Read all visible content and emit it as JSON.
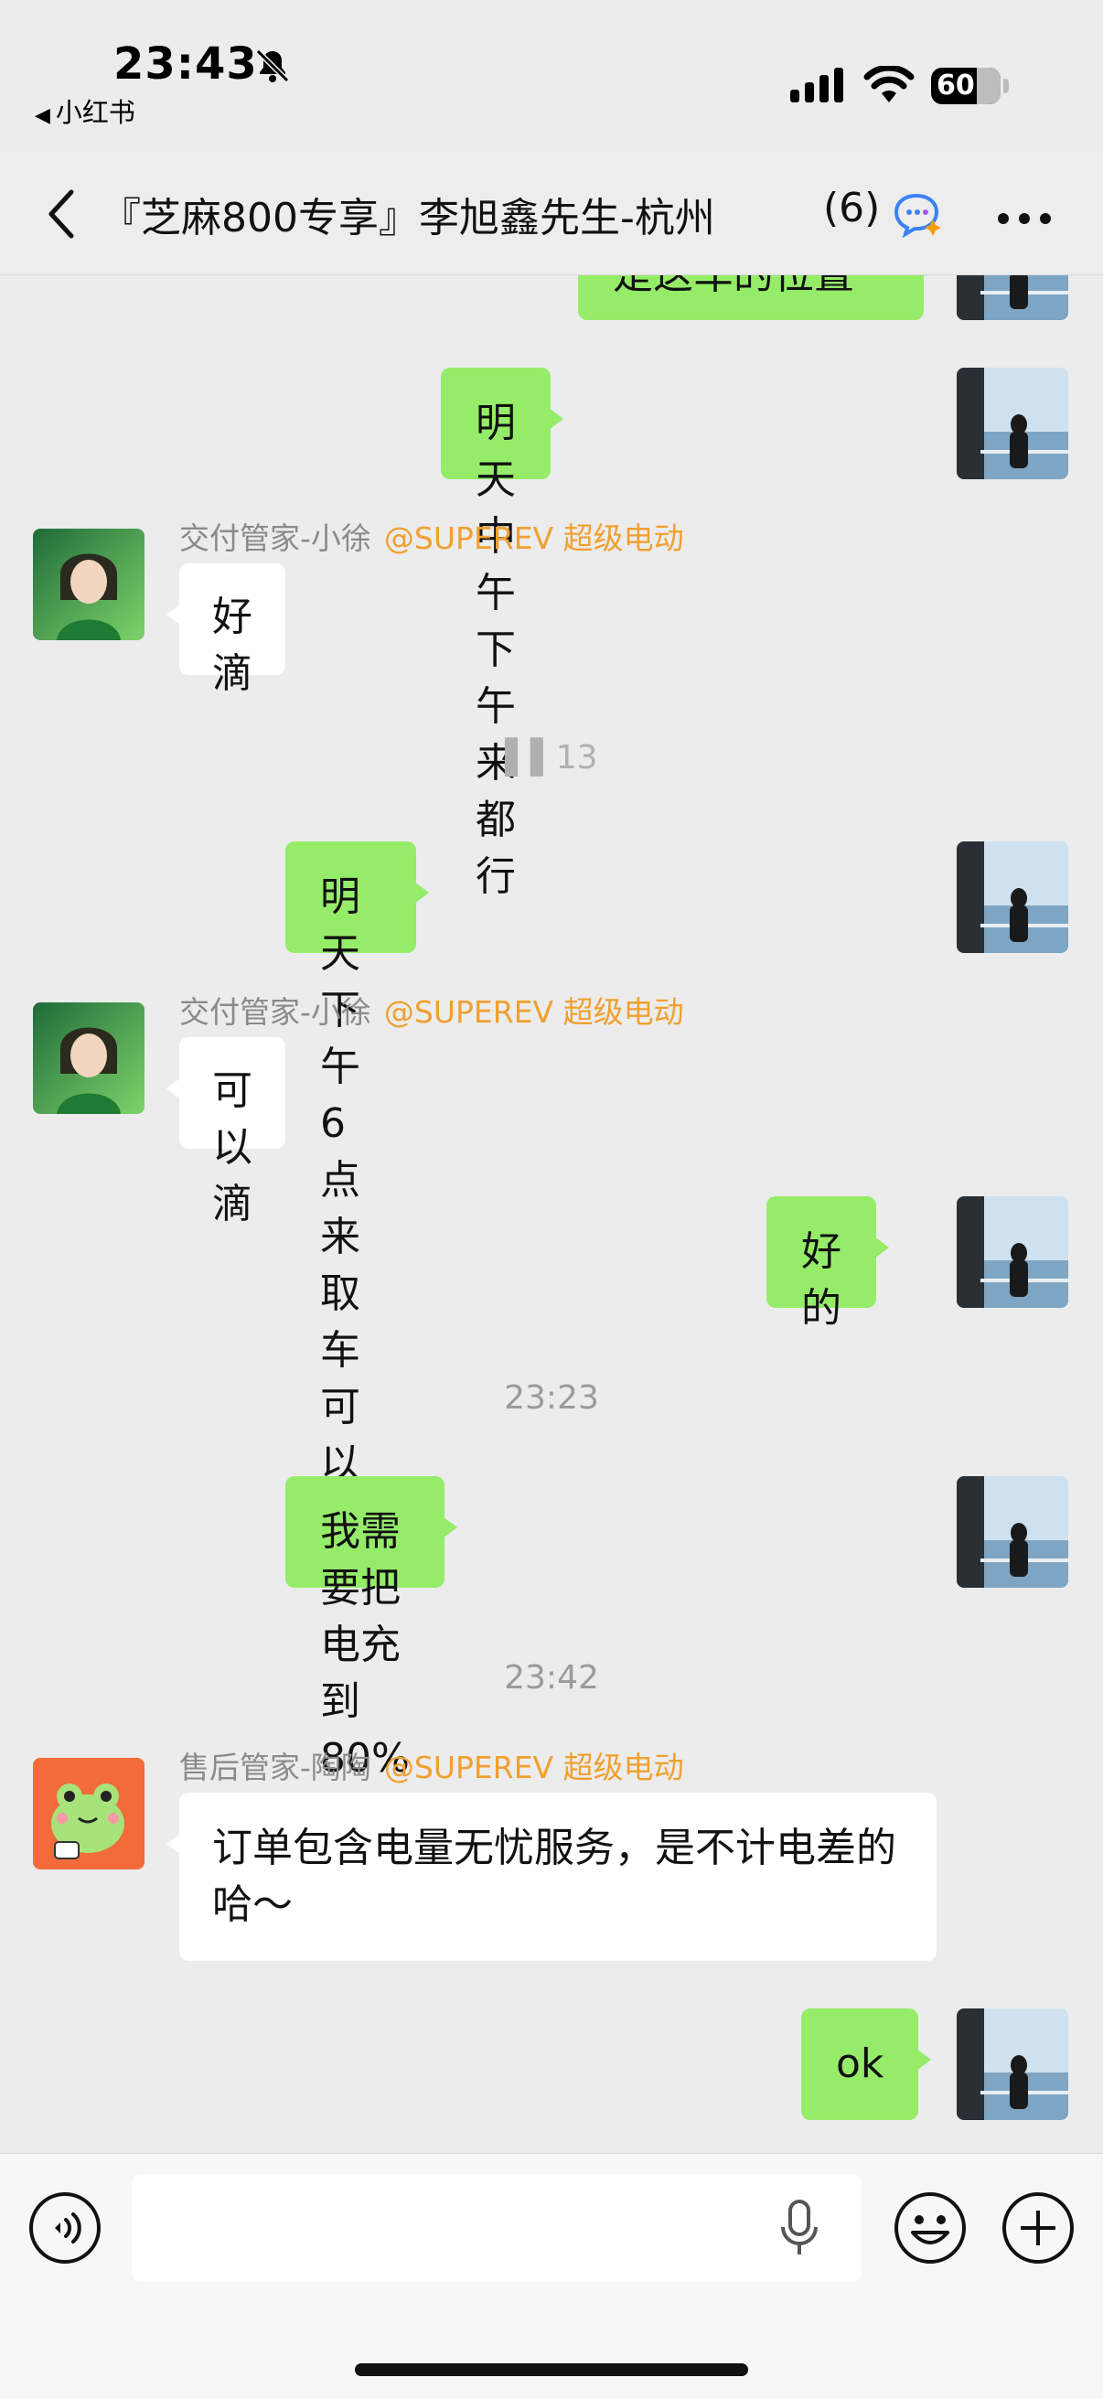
{
  "status": {
    "time": "23:43",
    "back_app": "小红书",
    "battery": "60"
  },
  "header": {
    "title": "『芝麻800专享』李旭鑫先生-杭州",
    "count": "(6)"
  },
  "messages": {
    "m0": {
      "text": "是这车的位置"
    },
    "m1": {
      "text": "明天中午下午来都行"
    },
    "m2": {
      "role": "交付管家-小徐",
      "org": "@SUPEREV 超级电动",
      "text": "好滴"
    },
    "recalled": "▌▌13",
    "m3": {
      "text": "明天下午 6 点来取车可以吗?"
    },
    "m4": {
      "role": "交付管家-小徐",
      "org": "@SUPEREV 超级电动",
      "text": "可以滴"
    },
    "m5": {
      "text": "好的"
    },
    "ts1": "23:23",
    "m6": {
      "text": "我需要把电充到 80% 以上吗"
    },
    "ts2": "23:42",
    "m7": {
      "role": "售后管家-陶陶",
      "org": "@SUPEREV 超级电动",
      "text": "订单包含电量无忧服务，是不计电差的哈～"
    },
    "m8": {
      "text": "ok"
    }
  },
  "input": {
    "placeholder": ""
  },
  "colors": {
    "bubble_me": "#95ec69",
    "bubble_other": "#ffffff",
    "org_accent": "#f0a030",
    "background": "#ececec"
  },
  "icons": [
    "bell-slash-icon",
    "signal-icon",
    "wifi-icon",
    "battery-icon",
    "back-chevron-icon",
    "chat-ai-icon",
    "more-icon",
    "voice-icon",
    "microphone-icon",
    "emoji-icon",
    "plus-icon"
  ]
}
